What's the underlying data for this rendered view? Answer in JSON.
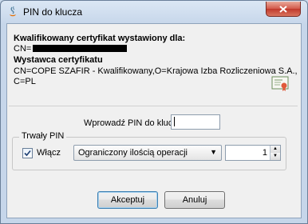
{
  "window": {
    "title": "PIN do klucza",
    "close_icon": "close-icon"
  },
  "certificate": {
    "holder_heading": "Kwalifikowany certyfikat wystawiony dla:",
    "holder_cn_prefix": "CN=",
    "issuer_heading": "Wystawca certyfikatu",
    "issuer_line1": "CN=COPE SZAFIR - Kwalifikowany,O=Krajowa Izba Rozliczeniowa S.A.,",
    "issuer_line2": "C=PL",
    "icon": "certificate-icon"
  },
  "pin": {
    "label": "Wprowadź PIN do klucza",
    "value": ""
  },
  "persistent_pin": {
    "group_title": "Trwały PIN",
    "enable_label": "Włącz",
    "enabled": true,
    "mode_selected": "Ograniczony ilością operacji",
    "count_value": "1"
  },
  "buttons": {
    "ok_label": "Akceptuj",
    "cancel_label": "Anuluj"
  },
  "colors": {
    "close_button": "#c0392b",
    "window_frame": "#c9d9ec"
  }
}
